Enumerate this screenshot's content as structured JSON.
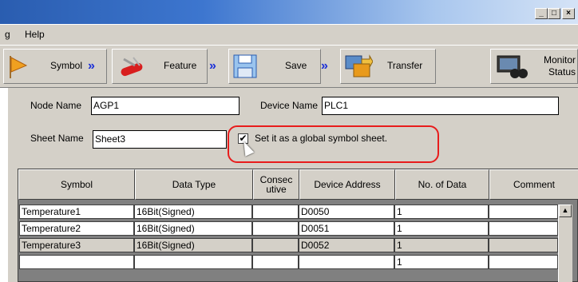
{
  "menu": {
    "item1": "g",
    "item2": "Help"
  },
  "window_buttons": {
    "minimize": "_",
    "maximize": "□",
    "close": "×"
  },
  "toolbar": {
    "symbol": "Symbol",
    "feature": "Feature",
    "save": "Save",
    "transfer": "Transfer",
    "monitor_line1": "Monitor",
    "monitor_line2": "Status",
    "arrow": "»"
  },
  "form": {
    "node_name_label": "Node Name",
    "node_name_value": "AGP1",
    "device_name_label": "Device Name",
    "device_name_value": "PLC1",
    "sheet_name_label": "Sheet Name",
    "sheet_name_value": "Sheet3",
    "global_checkbox_label": "Set it as a global symbol sheet.",
    "global_checkbox_mark": "✔"
  },
  "grid": {
    "headers": [
      "Symbol",
      "Data Type",
      "Consec utive",
      "Device Address",
      "No. of Data",
      "Comment"
    ],
    "rows": [
      [
        "Temperature1",
        "16Bit(Signed)",
        "",
        "D0050",
        "1",
        ""
      ],
      [
        "Temperature2",
        "16Bit(Signed)",
        "",
        "D0051",
        "1",
        ""
      ],
      [
        "Temperature3",
        "16Bit(Signed)",
        "",
        "D0052",
        "1",
        ""
      ],
      [
        "",
        "",
        "",
        "",
        "1",
        ""
      ]
    ],
    "scroll_up": "▲"
  },
  "colors": {
    "highlight": "#e81c1c",
    "arrow": "#1a2fd8",
    "face": "#d4d0c8"
  }
}
